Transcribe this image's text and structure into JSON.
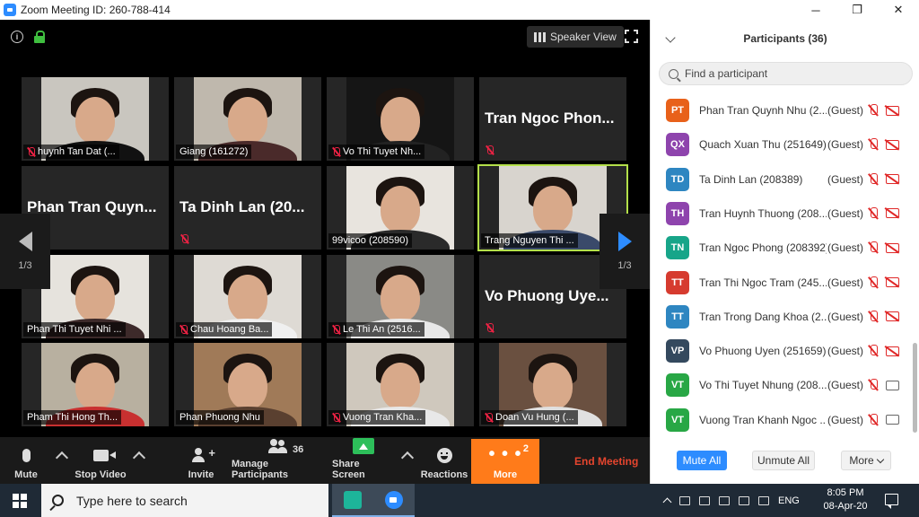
{
  "window": {
    "title": "Zoom Meeting ID: 260-788-414",
    "minimize": "─",
    "maximize": "❐",
    "close": "✕"
  },
  "meeting": {
    "view_button": "Speaker View",
    "page_left": "1/3",
    "page_right": "1/3",
    "tiles": [
      {
        "label": "huynh Tan Dat (...",
        "type": "video",
        "muted": true,
        "bg": "#c9c6bf",
        "shirt": "#111111"
      },
      {
        "label": "Giang (161272)",
        "type": "video",
        "muted": false,
        "bg": "#bfb8ad",
        "shirt": "#4a2a2a"
      },
      {
        "label": "Vo Thi Tuyet Nh...",
        "type": "video",
        "muted": true,
        "bg": "#151515",
        "shirt": "#222222"
      },
      {
        "avatar": "Tran Ngoc Phon...",
        "type": "avatar",
        "muted": true
      },
      {
        "avatar": "Phan Tran Quyn...",
        "type": "avatar",
        "muted": false
      },
      {
        "avatar": "Ta Dinh Lan (20...",
        "type": "avatar",
        "muted": true
      },
      {
        "label": "99vicoo (208590)",
        "type": "video",
        "muted": false,
        "bg": "#e8e4de",
        "shirt": "#2a2a2a"
      },
      {
        "label": "Trang Nguyen Thi ...",
        "type": "video",
        "muted": false,
        "bg": "#d8d4ce",
        "shirt": "#3a4a6a",
        "active": true
      },
      {
        "label": "Phan Thi Tuyet Nhi ...",
        "type": "video",
        "muted": false,
        "bg": "#e6e3dd",
        "shirt": "#3d2a2a"
      },
      {
        "label": "Chau Hoang Ba...",
        "type": "video",
        "muted": true,
        "bg": "#dedad4",
        "shirt": "#f0f0f0"
      },
      {
        "label": "Le Thi An (2516...",
        "type": "video",
        "muted": true,
        "bg": "#8a8a86",
        "shirt": "#e8e8e8"
      },
      {
        "avatar": "Vo Phuong Uye...",
        "type": "avatar",
        "muted": true
      },
      {
        "label": "Pham Thi Hong Th...",
        "type": "video",
        "muted": false,
        "bg": "#b8b0a0",
        "shirt": "#c83030"
      },
      {
        "label": "Phan Phuong Nhu",
        "type": "video",
        "muted": false,
        "bg": "#a07a58",
        "shirt": "#5a4030"
      },
      {
        "label": "Vuong Tran Kha...",
        "type": "video",
        "muted": true,
        "bg": "#cfc8bd",
        "shirt": "#e8e8e8"
      },
      {
        "label": "Doan Vu Hung (...",
        "type": "video",
        "muted": true,
        "bg": "#6a5040",
        "shirt": "#e0e0e0"
      }
    ]
  },
  "toolbar": {
    "mute": "Mute",
    "stop_video": "Stop Video",
    "invite": "Invite",
    "manage_participants": "Manage Participants",
    "participant_count": "36",
    "share_screen": "Share Screen",
    "reactions": "Reactions",
    "more": "More",
    "more_badge": "2",
    "more_dots": "• • •",
    "end_meeting": "End Meeting",
    "invite_plus": "+"
  },
  "panel": {
    "title": "Participants (36)",
    "search_placeholder": "Find a participant",
    "participants": [
      {
        "initials": "PT",
        "color": "#e8611a",
        "name": "Phan Tran Quynh  Nhu (2...",
        "role": "(Guest)",
        "cam": "off"
      },
      {
        "initials": "QX",
        "color": "#8e44ad",
        "name": "Quach Xuan Thu (251649)",
        "role": "(Guest)",
        "cam": "off"
      },
      {
        "initials": "TD",
        "color": "#2e86c1",
        "name": "Ta Dinh Lan (208389)",
        "role": "(Guest)",
        "cam": "off"
      },
      {
        "initials": "TH",
        "color": "#8e44ad",
        "name": "Tran Huynh Thuong (208...",
        "role": "(Guest)",
        "cam": "off"
      },
      {
        "initials": "TN",
        "color": "#17a589",
        "name": "Tran Ngoc Phong (208392)",
        "role": "(Guest)",
        "cam": "off"
      },
      {
        "initials": "TT",
        "color": "#d63b2f",
        "name": "Tran Thi Ngoc Tram (245...",
        "role": "(Guest)",
        "cam": "off"
      },
      {
        "initials": "TT",
        "color": "#2e86c1",
        "name": "Tran Trong Dang Khoa (2...",
        "role": "(Guest)",
        "cam": "off"
      },
      {
        "initials": "VP",
        "color": "#34495e",
        "name": "Vo Phuong Uyen (251659)",
        "role": "(Guest)",
        "cam": "off"
      },
      {
        "initials": "VT",
        "color": "#28a745",
        "name": "Vo Thi Tuyet Nhung (208...",
        "role": "(Guest)",
        "cam": "on"
      },
      {
        "initials": "VT",
        "color": "#28a745",
        "name": "Vuong Tran Khanh Ngoc ...",
        "role": "(Guest)",
        "cam": "on"
      }
    ],
    "mute_all": "Mute All",
    "unmute_all": "Unmute All",
    "more": "More"
  },
  "taskbar": {
    "search_placeholder": "Type here to search",
    "language": "ENG",
    "time": "8:05 PM",
    "date": "08-Apr-20"
  }
}
